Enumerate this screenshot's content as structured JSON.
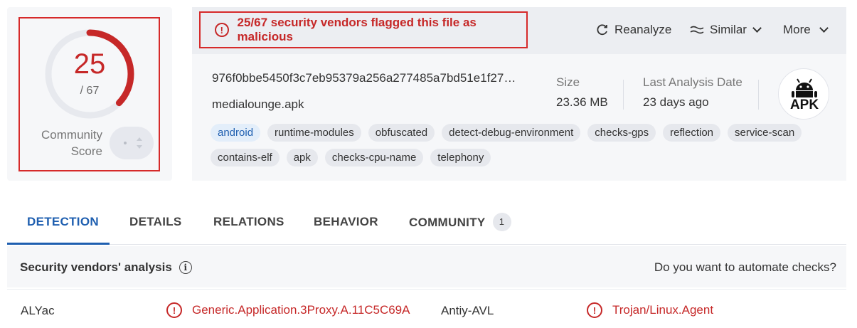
{
  "score": {
    "detected": "25",
    "total": "/ 67",
    "detected_fraction": 0.373,
    "community_label_line1": "Community",
    "community_label_line2": "Score"
  },
  "banner": {
    "text": "25/67 security vendors flagged this file as malicious",
    "icon": "!"
  },
  "actions": {
    "reanalyze": "Reanalyze",
    "similar": "Similar",
    "more": "More"
  },
  "file": {
    "hash": "976f0bbe5450f3c7eb95379a256a277485a7bd51e1f27a…",
    "name": "medialounge.apk",
    "size_label": "Size",
    "size_value": "23.36 MB",
    "date_label": "Last Analysis Date",
    "date_value": "23 days ago",
    "type_badge": "APK"
  },
  "tags": {
    "row1": [
      "android",
      "runtime-modules",
      "obfuscated",
      "detect-debug-environment",
      "checks-gps",
      "reflection",
      "service-scan"
    ],
    "row2": [
      "contains-elf",
      "apk",
      "checks-cpu-name",
      "telephony"
    ]
  },
  "tabs": {
    "detection": "DETECTION",
    "details": "DETAILS",
    "relations": "RELATIONS",
    "behavior": "BEHAVIOR",
    "community": "COMMUNITY",
    "community_count": "1"
  },
  "vendors": {
    "title": "Security vendors' analysis",
    "info_icon": "i",
    "automate": "Do you want to automate checks?",
    "rows": [
      {
        "vendor1": "ALYac",
        "result1": "Generic.Application.3Proxy.A.11C5C69A",
        "vendor2": "Antiy-AVL",
        "result2": "Trojan/Linux.Agent"
      }
    ]
  },
  "colors": {
    "malicious": "#c62828",
    "accent": "#1f5fb0",
    "panel": "#f6f7f9"
  }
}
